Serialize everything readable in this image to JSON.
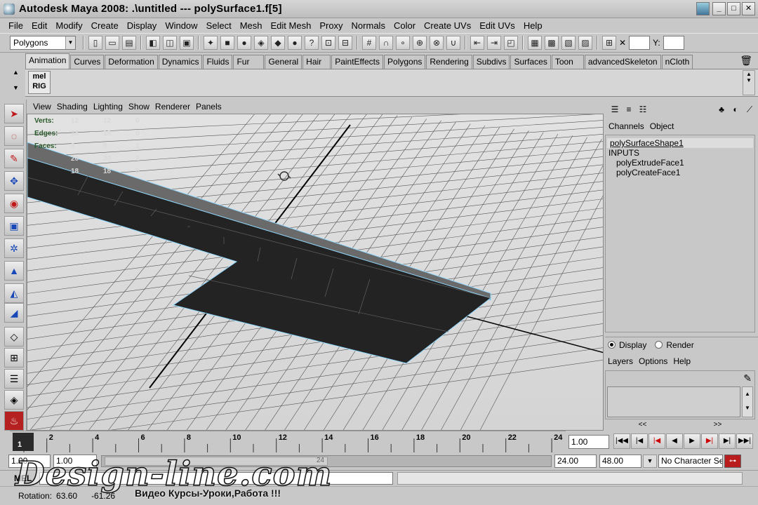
{
  "window": {
    "title": "Autodesk Maya 2008: .\\untitled   ---   polySurface1.f[5]"
  },
  "menus": [
    "File",
    "Edit",
    "Modify",
    "Create",
    "Display",
    "Window",
    "Select",
    "Mesh",
    "Edit Mesh",
    "Proxy",
    "Normals",
    "Color",
    "Create UVs",
    "Edit UVs",
    "Help"
  ],
  "toolbar": {
    "mode": "Polygons",
    "y_label": "Y:",
    "x_close": "✕"
  },
  "shelf": {
    "tabs": [
      "Animation",
      "Curves",
      "Deformation",
      "Dynamics",
      "Fluids",
      "Fur",
      "General",
      "Hair",
      "PaintEffects",
      "Polygons",
      "Rendering",
      "Subdivs",
      "Surfaces",
      "Toon",
      "advancedSkeleton",
      "nCloth"
    ],
    "active": "Animation",
    "button_top": "mel",
    "button_bottom": "RIG"
  },
  "panel_menus": [
    "View",
    "Shading",
    "Lighting",
    "Show",
    "Renderer",
    "Panels"
  ],
  "hud": [
    {
      "label": "Verts:",
      "a": "12",
      "b": "12",
      "c": "0"
    },
    {
      "label": "Edges:",
      "a": "18",
      "b": "18",
      "c": "0"
    },
    {
      "label": "Faces:",
      "a": "8",
      "b": "8",
      "c": "1"
    },
    {
      "label": "",
      "a": "20",
      "b": "20",
      "c": "2"
    },
    {
      "label": "",
      "a": "18",
      "b": "18",
      "c": "0"
    }
  ],
  "channel_box": {
    "menus": [
      "Channels",
      "Object"
    ],
    "shape": "polySurfaceShape1",
    "inputs_label": "INPUTS",
    "inputs": [
      "polyExtrudeFace1",
      "polyCreateFace1"
    ]
  },
  "layers": {
    "display": "Display",
    "render": "Render",
    "menus": [
      "Layers",
      "Options",
      "Help"
    ],
    "pager_left": "<<",
    "pager_right": ">>"
  },
  "timeline": {
    "ticks": [
      "2",
      "4",
      "6",
      "8",
      "10",
      "12",
      "14",
      "16",
      "18",
      "20",
      "22",
      "24"
    ],
    "current": "1",
    "current_field": "1.00"
  },
  "range": {
    "start": "1.00",
    "inner_start": "1.00",
    "inner_end_label": "24",
    "end": "24.00",
    "max": "48.00",
    "character": "No Character Set"
  },
  "command": {
    "label": "MEL"
  },
  "help": {
    "rotation_label": "Rotation:",
    "rotation_x": "63.60",
    "rotation_y": "-61.26"
  },
  "watermark": {
    "site": "Design-line.com",
    "tagline": "Видео Курсы-Уроки,Работа !!!"
  }
}
